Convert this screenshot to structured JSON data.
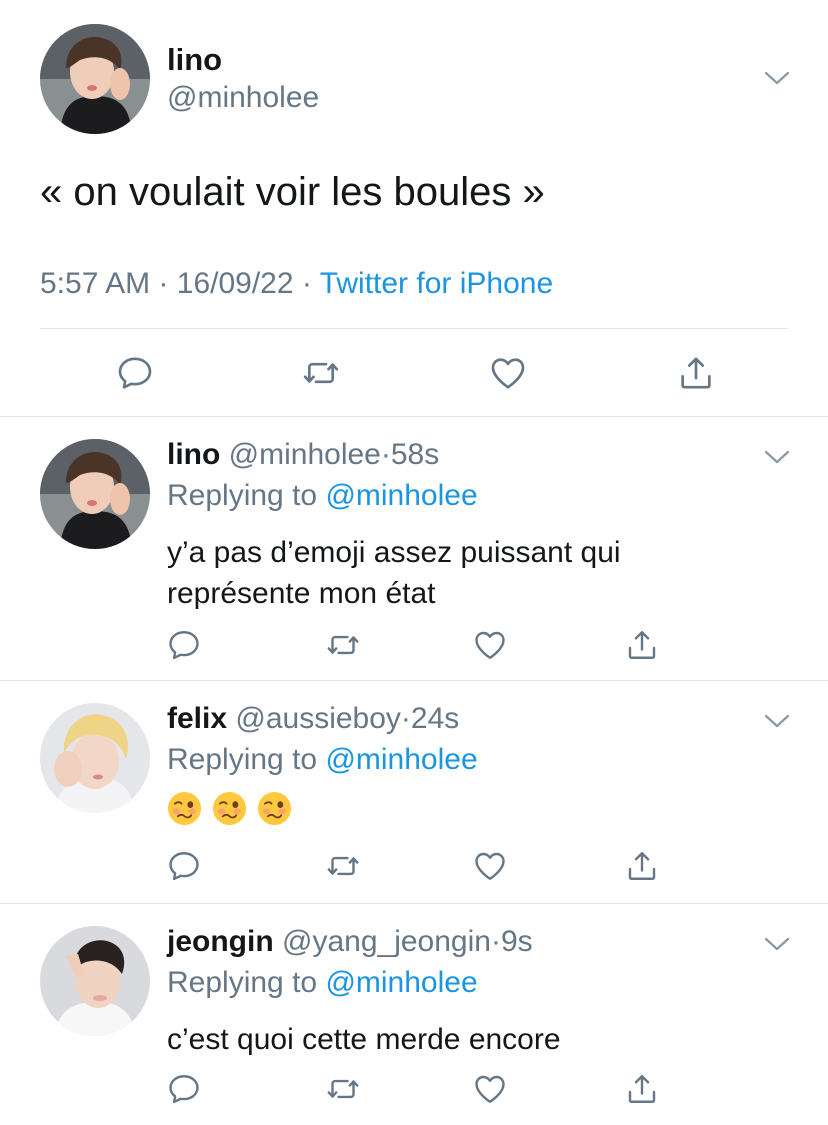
{
  "main_tweet": {
    "author_name": "lino",
    "author_handle": "@minholee",
    "text": "« on voulait voir les boules »",
    "time": "5:57 AM",
    "date": "16/09/22",
    "source": "Twitter for iPhone",
    "separator": "·"
  },
  "replies": [
    {
      "author_name": "lino",
      "author_handle": "@minholee",
      "separator": "·",
      "time_ago": "58s",
      "replying_prefix": "Replying to",
      "replying_to": "@minholee",
      "text_line1": "y’a pas d’emoji assez puissant qui",
      "text_line2": "représente mon état"
    },
    {
      "author_name": "felix",
      "author_handle": "@aussieboy",
      "separator": "·",
      "time_ago": "24s",
      "replying_prefix": "Replying to",
      "replying_to": "@minholee",
      "emoji_count": 3,
      "emoji": "woozy-face"
    },
    {
      "author_name": "jeongin",
      "author_handle": "@yang_jeongin",
      "separator": "·",
      "time_ago": "9s",
      "replying_prefix": "Replying to",
      "replying_to": "@minholee",
      "text_line1": "c’est quoi cette merde encore"
    }
  ],
  "colors": {
    "primary_text": "#14171a",
    "secondary_text": "#657786",
    "link": "#1b95e0",
    "divider": "#e1e8ed"
  },
  "icons": [
    "reply-icon",
    "retweet-icon",
    "like-icon",
    "share-icon",
    "chevron-down-icon",
    "woozy-face-emoji"
  ]
}
